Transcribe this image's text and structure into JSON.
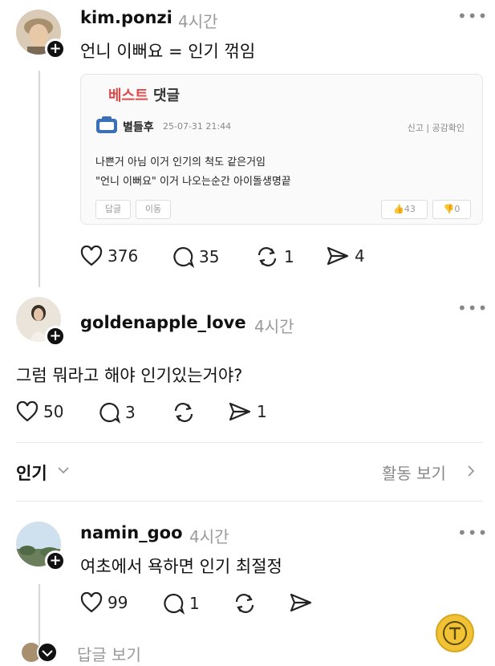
{
  "posts": [
    {
      "username": "kim.ponzi",
      "time": "4시간",
      "text": "언니 이뻐요 = 인기 꺾임",
      "stats": {
        "likes": "376",
        "comments": "35",
        "reposts": "1",
        "shares": "4"
      }
    },
    {
      "username": "goldenapple_love",
      "time": "4시간",
      "text": "그럼 뭐라고 해야 인기있는거야?",
      "stats": {
        "likes": "50",
        "comments": "3",
        "reposts": "",
        "shares": "1"
      }
    },
    {
      "username": "namin_goo",
      "time": "4시간",
      "text": "여초에서 욕하면 인기 최절정",
      "stats": {
        "likes": "99",
        "comments": "1",
        "reposts": "",
        "shares": ""
      }
    }
  ],
  "embedded_card": {
    "title_red": "베스트",
    "title_dark": "댓글",
    "author": "별들후",
    "date": "25-07-31 21:44",
    "report": "신고 | 공감확인",
    "line1": "나쁜거 아님 이거 인기의 척도 같은거임",
    "line2": "\"언니 이뻐요\" 이거 나오는순간 아이돌생명끝",
    "btn_reply": "답글",
    "btn_move": "이동",
    "up_count": "43",
    "down_count": "0"
  },
  "sort": {
    "label": "인기",
    "activity": "활동 보기"
  },
  "reply_view": "답글 보기",
  "more_icon": "•••",
  "colors": {
    "accent_fab": "#f1c233",
    "best_red": "#e14a4a"
  }
}
